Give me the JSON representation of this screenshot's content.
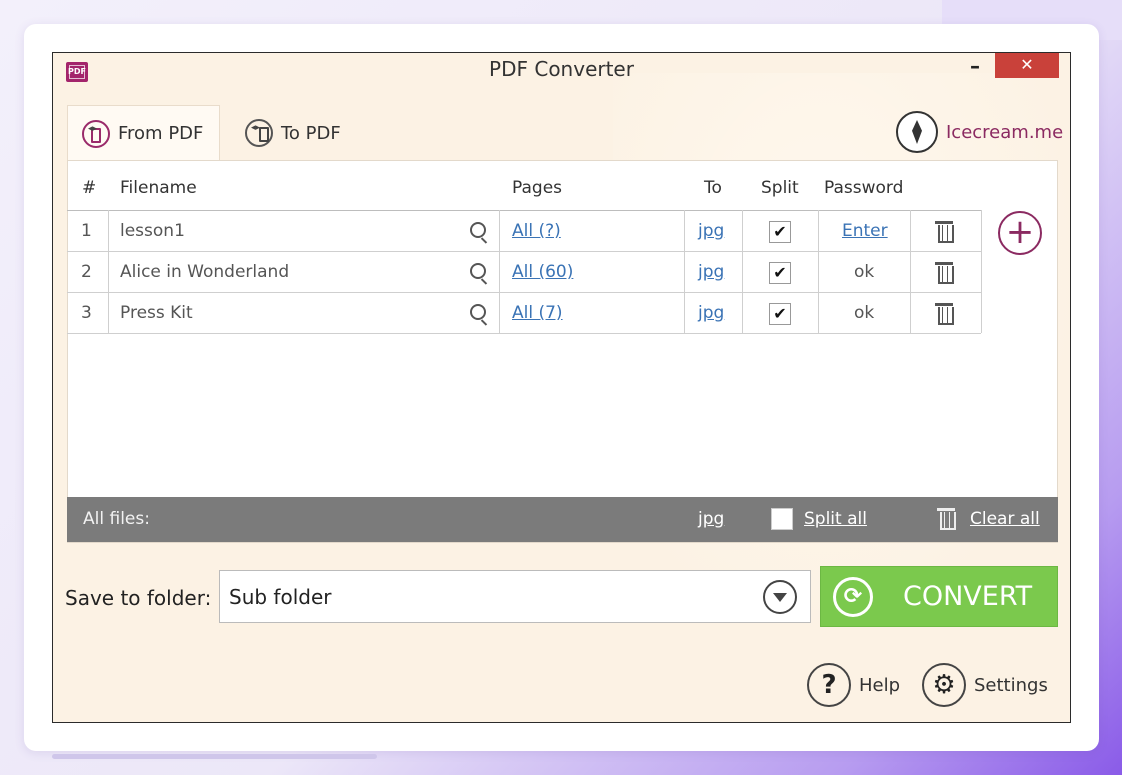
{
  "window": {
    "title": "PDF Converter",
    "app_icon_text": "PDF",
    "minimize": "–",
    "close": "✕"
  },
  "tabs": [
    {
      "label": "From PDF",
      "active": true
    },
    {
      "label": "To PDF",
      "active": false
    }
  ],
  "brand": {
    "label": "Icecream.me"
  },
  "columns": {
    "num": "#",
    "filename": "Filename",
    "pages": "Pages",
    "to": "To",
    "split": "Split",
    "password": "Password"
  },
  "rows": [
    {
      "num": "1",
      "filename": "lesson1",
      "pages": "All (?)",
      "to": "jpg",
      "split": true,
      "split_mark": "✔",
      "password": "Enter",
      "password_link": true
    },
    {
      "num": "2",
      "filename": "Alice in Wonderland",
      "pages": "All (60)",
      "to": "jpg",
      "split": true,
      "split_mark": "✔",
      "password": "ok",
      "password_link": false
    },
    {
      "num": "3",
      "filename": "Press Kit",
      "pages": "All (7)",
      "to": "jpg",
      "split": true,
      "split_mark": "✔",
      "password": "ok",
      "password_link": false
    }
  ],
  "add_button": "+",
  "all_files": {
    "label": "All files:",
    "format": "jpg",
    "split_all": "Split all",
    "clear_all": "Clear all"
  },
  "save": {
    "label": "Save to folder:",
    "value": "Sub folder"
  },
  "convert": {
    "label": "CONVERT",
    "icon": "⟳"
  },
  "footer": {
    "help": "Help",
    "help_icon": "?",
    "settings": "Settings",
    "settings_icon": "⚙"
  },
  "colors": {
    "accent": "#8b2a61",
    "convert": "#7bc94d",
    "close": "#c9413a",
    "link": "#3a73b5"
  }
}
